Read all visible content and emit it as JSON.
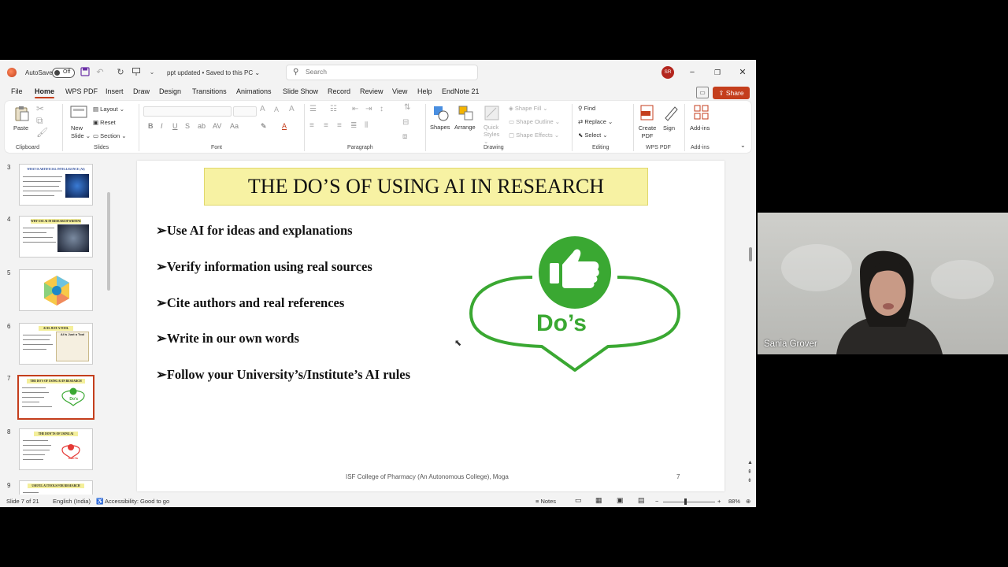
{
  "titlebar": {
    "autosave_label": "AutoSave",
    "autosave_state": "Off",
    "doc_title": "ppt updated • Saved to this PC ⌄",
    "search_placeholder": "Search",
    "avatar_initials": "SR"
  },
  "menu": {
    "tabs": [
      "File",
      "Home",
      "WPS PDF",
      "Insert",
      "Draw",
      "Design",
      "Transitions",
      "Animations",
      "Slide Show",
      "Record",
      "Review",
      "View",
      "Help",
      "EndNote 21"
    ],
    "active": "Home",
    "share_label": "Share"
  },
  "ribbon": {
    "clipboard": {
      "paste": "Paste",
      "group": "Clipboard"
    },
    "slides": {
      "new_slide": "New Slide ⌄",
      "layout": "Layout ⌄",
      "reset": "Reset",
      "section": "Section ⌄",
      "group": "Slides"
    },
    "font": {
      "group": "Font"
    },
    "paragraph": {
      "group": "Paragraph"
    },
    "drawing": {
      "shapes": "Shapes",
      "arrange": "Arrange",
      "quick_styles": "Quick Styles ⌄",
      "shape_fill": "Shape Fill ⌄",
      "shape_outline": "Shape Outline ⌄",
      "shape_effects": "Shape Effects ⌄",
      "group": "Drawing"
    },
    "editing": {
      "find": "Find",
      "replace": "Replace ⌄",
      "select": "Select ⌄",
      "group": "Editing"
    },
    "wps": {
      "create_pdf": "Create PDF",
      "sign": "Sign",
      "group": "WPS PDF"
    },
    "addins": {
      "addins": "Add-ins",
      "group": "Add-ins"
    }
  },
  "thumbnails": [
    {
      "num": "3",
      "title": "WHAT IS ARTIFICIAL INTELLIGENCE (AI)"
    },
    {
      "num": "4",
      "title": "WHY USE AI IN RESEARCH WRITING"
    },
    {
      "num": "5",
      "title": ""
    },
    {
      "num": "6",
      "title": "AI IS JUST A TOOL"
    },
    {
      "num": "7",
      "title": "THE DO'S OF USING AI IN RESEARCH",
      "selected": true
    },
    {
      "num": "8",
      "title": "THE DON'TS OF USING AI"
    },
    {
      "num": "9",
      "title": "USEFUL AI TOOLS FOR RESEARCH"
    }
  ],
  "thumb_texts": {
    "t6_img": "AI Is Just a Tool",
    "t7_img": "Do's",
    "t8_img": "Don'ts"
  },
  "slide": {
    "title": "THE DO’S OF USING AI IN RESEARCH",
    "bullets": [
      "➢Use AI for ideas and explanations",
      "➢Verify information using real sources",
      "➢Cite authors and real references",
      "➢Write in our own words",
      "➢Follow your University’s/Institute’s AI rules"
    ],
    "graphic_label": "Do’s",
    "footer": "ISF College of Pharmacy (An Autonomous College), Moga",
    "page_number": "7",
    "colors": {
      "title_bg": "#f7f2a3",
      "graphic_green": "#3aa832",
      "accent": "#c43e1c"
    }
  },
  "status": {
    "slide_count": "Slide 7 of 21",
    "language": "English (India)",
    "accessibility": "Accessibility: Good to go",
    "notes": "Notes",
    "zoom": "88%"
  },
  "video": {
    "participant_name": "Sania Grover"
  }
}
